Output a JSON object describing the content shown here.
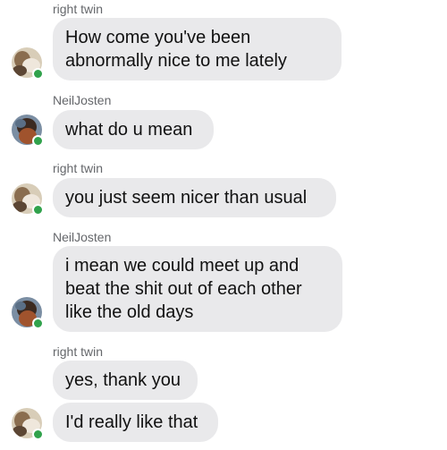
{
  "messages": {
    "group1": {
      "sender": "right twin",
      "bubble1": [
        "How come you've been",
        "abnormally nice to me lately"
      ]
    },
    "group2": {
      "sender": "NeilJosten",
      "bubble1": "what do u mean"
    },
    "group3": {
      "sender": "right twin",
      "bubble1": "you just seem nicer than usual"
    },
    "group4": {
      "sender": "NeilJosten",
      "bubble1": [
        "i mean we could meet up and",
        "beat the shit out of each other",
        "like the old days"
      ]
    },
    "group5": {
      "sender": "right twin",
      "bubble1": "yes, thank you",
      "bubble2": "I'd really like that"
    }
  },
  "avatars": {
    "right_twin": "avatar-right-twin",
    "neil_josten": "avatar-neil-josten"
  },
  "colors": {
    "bubble": "#e9e9eb",
    "online": "#31a24c",
    "sender_text": "#65676b"
  }
}
